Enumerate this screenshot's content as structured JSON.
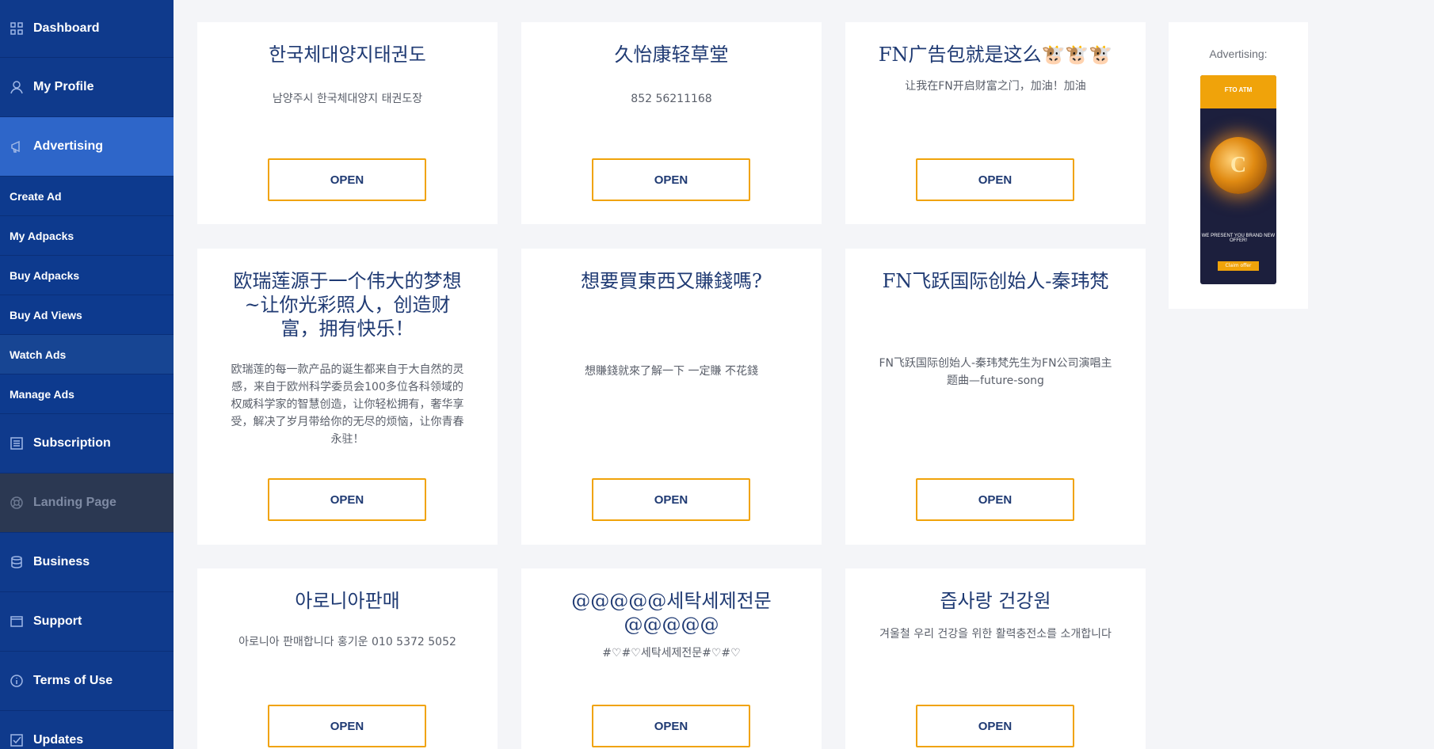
{
  "sidebar": {
    "items": [
      {
        "label": "Dashboard",
        "icon": "grid-icon"
      },
      {
        "label": "My Profile",
        "icon": "user-icon"
      },
      {
        "label": "Advertising",
        "icon": "megaphone-icon"
      },
      {
        "label": "Subscription",
        "icon": "list-icon"
      },
      {
        "label": "Landing Page",
        "icon": "lifebuoy-icon"
      },
      {
        "label": "Business",
        "icon": "database-icon"
      },
      {
        "label": "Support",
        "icon": "window-icon"
      },
      {
        "label": "Terms of Use",
        "icon": "info-icon"
      },
      {
        "label": "Updates",
        "icon": "checkbox-icon"
      }
    ],
    "subitems": [
      {
        "label": "Create Ad"
      },
      {
        "label": "My Adpacks"
      },
      {
        "label": "Buy Adpacks"
      },
      {
        "label": "Buy Ad Views"
      },
      {
        "label": "Watch Ads"
      },
      {
        "label": "Manage Ads"
      }
    ]
  },
  "cards": [
    {
      "title": "한국체대양지태권도",
      "desc": "남양주시 한국체대양지 태권도장",
      "button": "OPEN"
    },
    {
      "title": "久怡康轻草堂",
      "desc": "852 56211168",
      "button": "OPEN"
    },
    {
      "title": "FN广告包就是这么🐮🐮🐮",
      "desc": "让我在FN开启财富之门，加油！加油",
      "button": "OPEN"
    },
    {
      "title": "欧瑞莲源于一个伟大的梦想~让你光彩照人，创造财富，拥有快乐！",
      "desc": "欧瑞莲的每一款产品的诞生都来自于大自然的灵感，来自于欧州科学委员会100多位各科领域的权威科学家的智慧创造，让你轻松拥有，奢华享受，解决了岁月带给你的无尽的烦恼，让你青春永驻！",
      "button": "OPEN"
    },
    {
      "title": "想要買東西又賺錢嗎?",
      "desc": "想賺錢就來了解一下 一定賺 不花錢",
      "button": "OPEN"
    },
    {
      "title": "FN飞跃国际创始人-秦玮梵",
      "desc": "FN飞跃国际创始人-秦玮梵先生为FN公司演唱主题曲—future-song",
      "button": "OPEN"
    },
    {
      "title": "아로니아판매",
      "desc": "아로니아 판매합니다 홍기운 010 5372 5052",
      "button": "OPEN"
    },
    {
      "title": "@@@@@세탁세제전문@@@@@",
      "desc": "#♡#♡세탁세제전문#♡#♡",
      "button": "OPEN"
    },
    {
      "title": "즙사랑 건강원",
      "desc": "겨울철 우리 건강을 위한 활력충전소를 소개합니다",
      "button": "OPEN"
    }
  ],
  "ad": {
    "label": "Advertising:",
    "banner_title": "FTO ATM",
    "banner_subtitle": "WE PRESENT YOU BRAND NEW OFFER!",
    "banner_cta": "Claim offer",
    "coin_letter": "C"
  },
  "colors": {
    "sidebar": "#0f3a8c",
    "active": "#2e66c9",
    "accent": "#f0a30a",
    "title": "#1f3a73"
  }
}
